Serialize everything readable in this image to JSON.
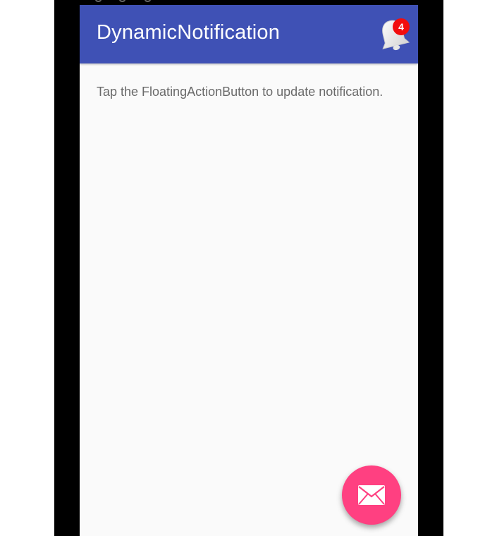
{
  "app_bar": {
    "title": "DynamicNotification",
    "notification_count": "4",
    "icon": "bell-icon"
  },
  "content": {
    "message": "Tap the FloatingActionButton to update notification."
  },
  "fab": {
    "icon": "mail-icon"
  },
  "colors": {
    "primary": "#3f51b5",
    "accent": "#ff4081",
    "badge": "#f20d0d",
    "background": "#fafafa"
  }
}
